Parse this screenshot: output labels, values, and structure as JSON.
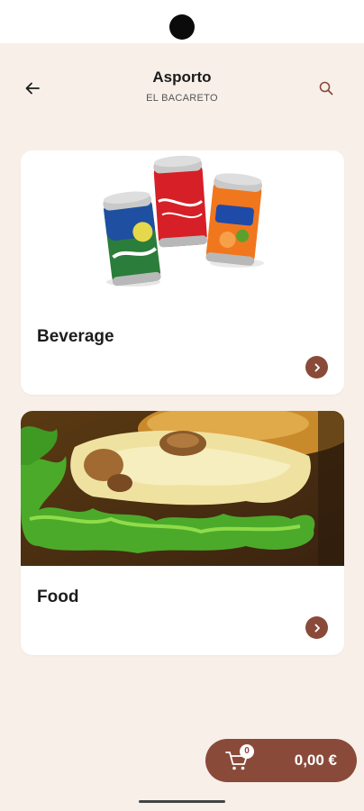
{
  "header": {
    "title": "Asporto",
    "subtitle": "EL BACARETO",
    "back_icon": "arrow-left-icon",
    "search_icon": "search-icon"
  },
  "categories": [
    {
      "label": "Beverage",
      "image": "soda-cans-image",
      "arrow_icon": "chevron-right-icon"
    },
    {
      "label": "Food",
      "image": "burger-image",
      "arrow_icon": "chevron-right-icon"
    }
  ],
  "cart": {
    "icon": "shopping-cart-icon",
    "count": "0",
    "total": "0,00 €"
  },
  "colors": {
    "accent": "#8a4a3a",
    "background": "#f8efe9",
    "card": "#ffffff"
  }
}
